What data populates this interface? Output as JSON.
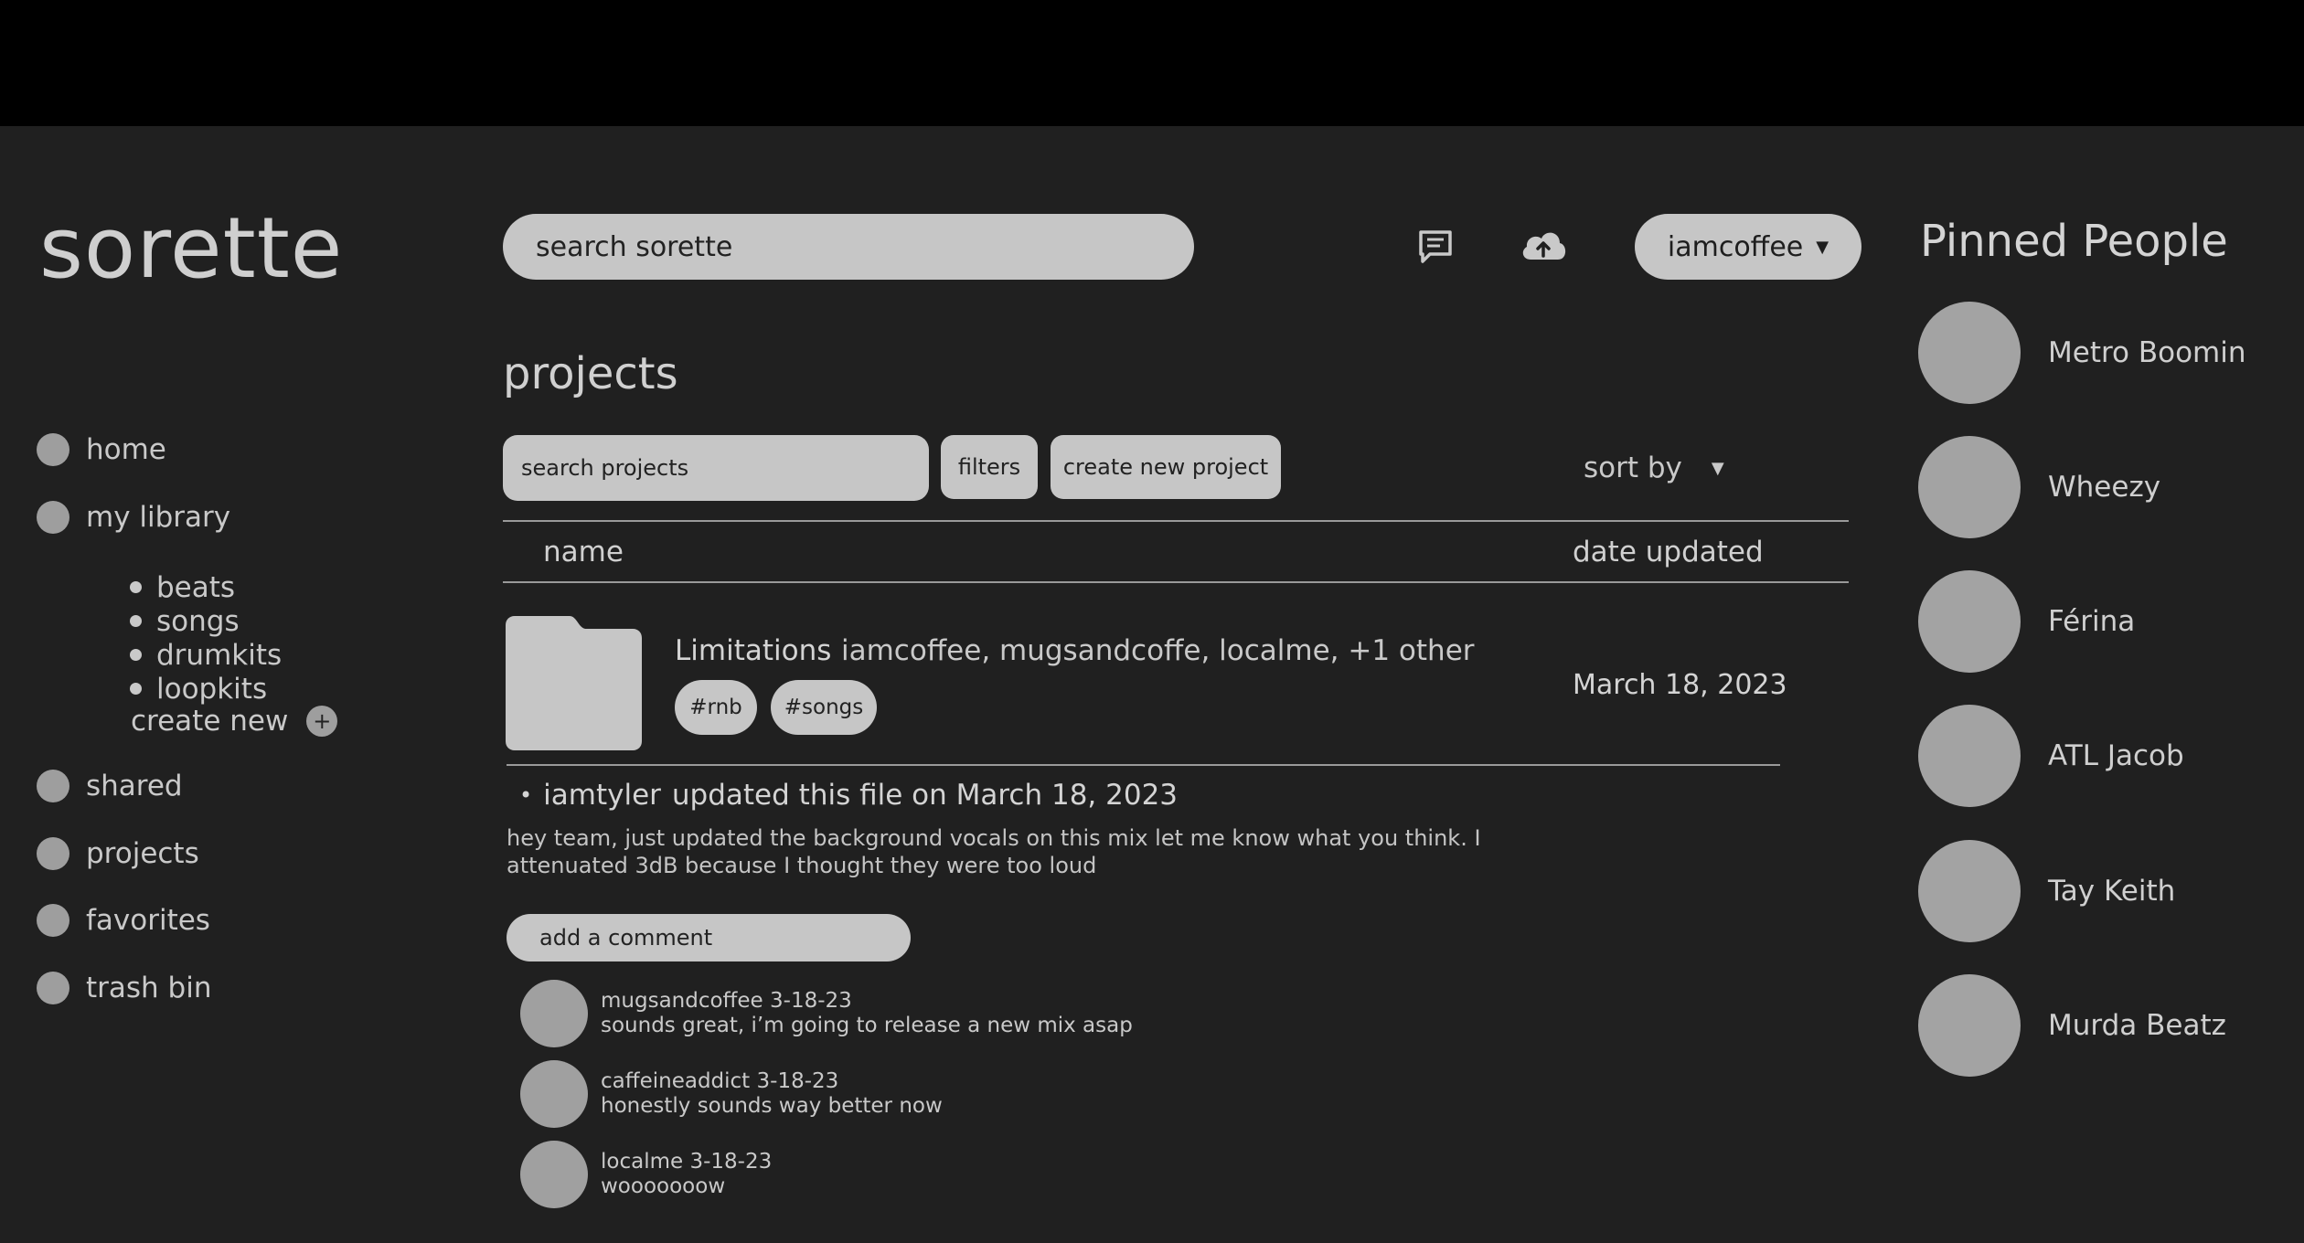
{
  "app": {
    "logo": "sorette"
  },
  "nav": {
    "home": "home",
    "my_library": "my library",
    "library_items": [
      "beats",
      "songs",
      "drumkits",
      "loopkits"
    ],
    "create_new": "create new",
    "create_new_icon": "plus-icon",
    "shared": "shared",
    "projects": "projects",
    "favorites": "favorites",
    "trash_bin": "trash bin"
  },
  "header": {
    "search_placeholder": "search sorette",
    "chat_icon": "message-icon",
    "upload_icon": "cloud-upload-icon",
    "user": "iamcoffee",
    "user_caret": "▼"
  },
  "projects": {
    "title": "projects",
    "search_placeholder": "search projects",
    "filters": "filters",
    "create": "create new project",
    "sort_by": "sort by",
    "sort_caret": "▼",
    "col_name": "name",
    "col_date": "date updated",
    "item": {
      "name": "Limitations",
      "members": "iamcoffee, mugsandcoffe, localme, +1 other",
      "tags": [
        "#rnb",
        "#songs"
      ],
      "date": "March 18, 2023"
    },
    "update": {
      "user": "iamtyler",
      "text": "updated this file on March 18, 2023",
      "message": "hey team, just updated the background vocals on this mix let me know what you think. I attenuated 3dB because I thought they were too loud"
    },
    "comment_placeholder": "add a comment",
    "comments": [
      {
        "user": "mugsandcoffee",
        "date": "3-18-23",
        "text": "sounds great, i’m going to release a new mix asap"
      },
      {
        "user": "caffeineaddict",
        "date": "3-18-23",
        "text": "honestly sounds way better now"
      },
      {
        "user": "localme",
        "date": "3-18-23",
        "text": "wooooooow"
      }
    ]
  },
  "pinned": {
    "title": "Pinned People",
    "people": [
      "Metro Boomin",
      "Wheezy",
      "Férina",
      "ATL Jacob",
      "Tay Keith",
      "Murda Beatz"
    ]
  }
}
